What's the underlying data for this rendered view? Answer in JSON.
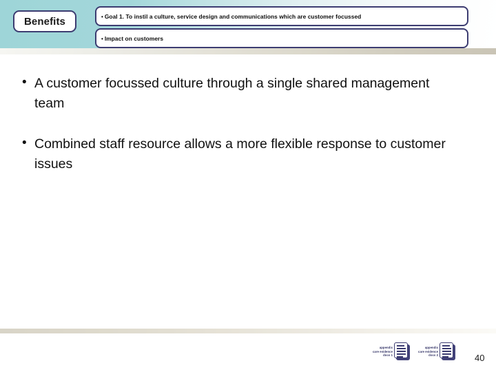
{
  "slide": {
    "header": {
      "badge_label": "Benefits",
      "boxes": [
        {
          "bullet": "•",
          "text": "Goal 1. To instil a culture, service design and communications which are customer focussed"
        },
        {
          "bullet": "•",
          "text": "Impact on customers"
        }
      ]
    },
    "body": {
      "bullets": [
        {
          "marker": "•",
          "text": "A customer focussed culture through a single shared management team"
        },
        {
          "marker": "•",
          "text": "Combined staff resource allows a more flexible response to customer issues"
        }
      ]
    },
    "footer": {
      "logos": [
        {
          "line1": "appendix",
          "line2": "care evidence",
          "line3": "docs 1"
        },
        {
          "line1": "appendix",
          "line2": "care evidence",
          "line3": "docs 2"
        }
      ],
      "page_number": "40"
    },
    "colors": {
      "header_teal": "#9ed5d8",
      "outline_navy": "#3c3c71",
      "footer_tan": "#d8d4c7",
      "text_dark": "#111111"
    }
  }
}
